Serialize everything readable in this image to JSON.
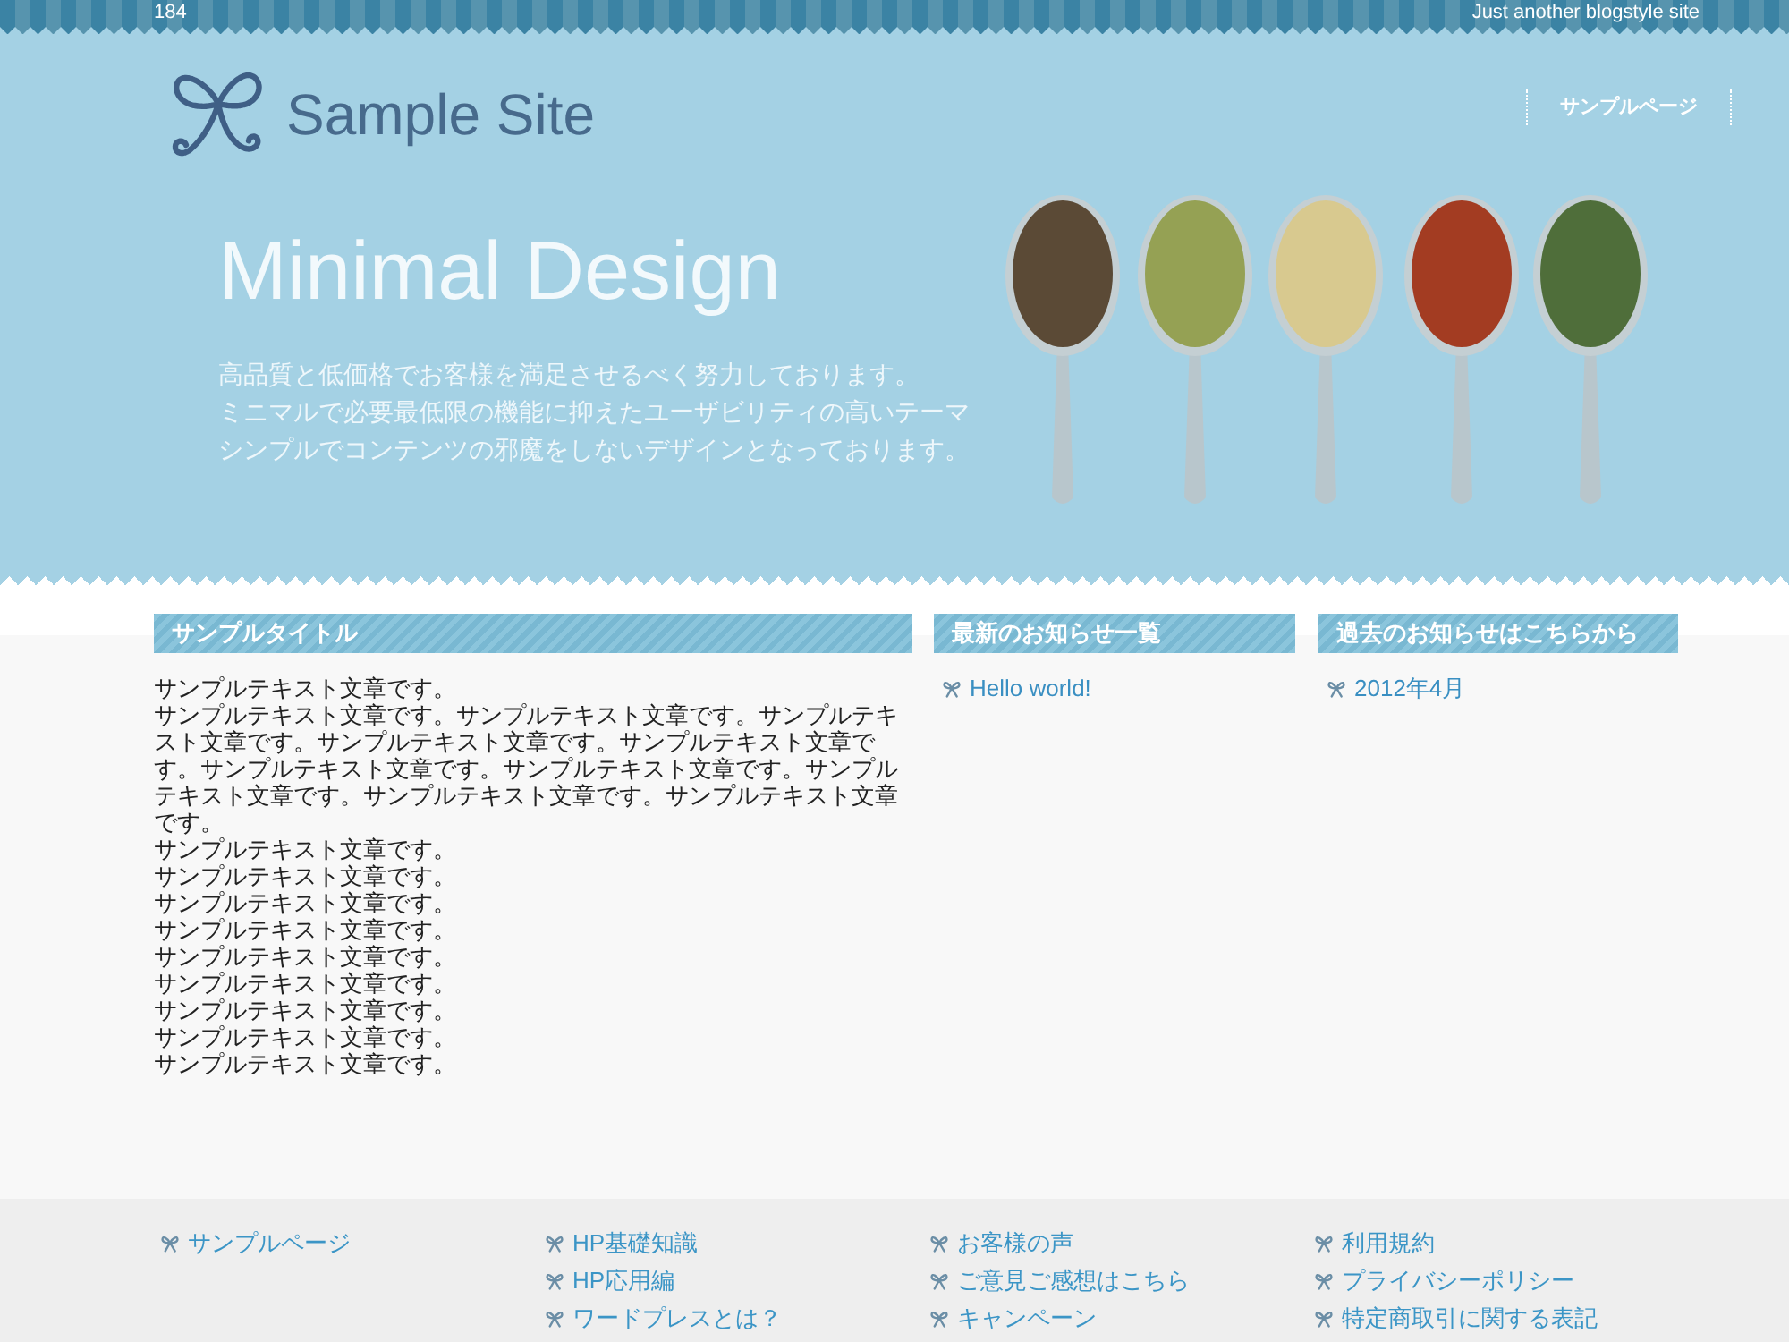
{
  "top_bar": {
    "number": "184",
    "tagline": "Just another blogstyle site"
  },
  "header": {
    "site_title": "Sample Site",
    "nav": [
      {
        "label": "サンプルページ"
      }
    ]
  },
  "hero": {
    "title": "Minimal Design",
    "lines": [
      "高品質と低価格でお客様を満足させるべく努力しております。",
      "ミニマルで必要最低限の機能に抑えたユーザビリティの高いテーマ",
      "シンプルでコンテンツの邪魔をしないデザインとなっております。"
    ]
  },
  "main": {
    "heading": "サンプルタイトル",
    "lines": [
      "サンプルテキスト文章です。",
      "サンプルテキスト文章です。サンプルテキスト文章です。サンプルテキスト文章です。サンプルテキスト文章です。サンプルテキスト文章です。サンプルテキスト文章です。サンプルテキスト文章です。サンプルテキスト文章です。サンプルテキスト文章です。サンプルテキスト文章です。",
      "サンプルテキスト文章です。",
      "サンプルテキスト文章です。",
      "サンプルテキスト文章です。",
      "サンプルテキスト文章です。",
      "サンプルテキスト文章です。",
      "サンプルテキスト文章です。",
      "サンプルテキスト文章です。",
      "サンプルテキスト文章です。",
      "サンプルテキスト文章です。"
    ]
  },
  "widgets": [
    {
      "heading": "最新のお知らせ一覧",
      "links": [
        "Hello world!"
      ]
    },
    {
      "heading": "過去のお知らせはこちらから",
      "links": [
        "2012年4月"
      ]
    }
  ],
  "footer": {
    "columns": [
      {
        "links": [
          "サンプルページ"
        ]
      },
      {
        "links": [
          "HP基礎知識",
          "HP応用編",
          "ワードプレスとは？"
        ]
      },
      {
        "links": [
          "お客様の声",
          "ご意見ご感想はこちら",
          "キャンペーン"
        ]
      },
      {
        "links": [
          "利用規約",
          "プライバシーポリシー",
          "特定商取引に関する表記"
        ]
      }
    ]
  }
}
